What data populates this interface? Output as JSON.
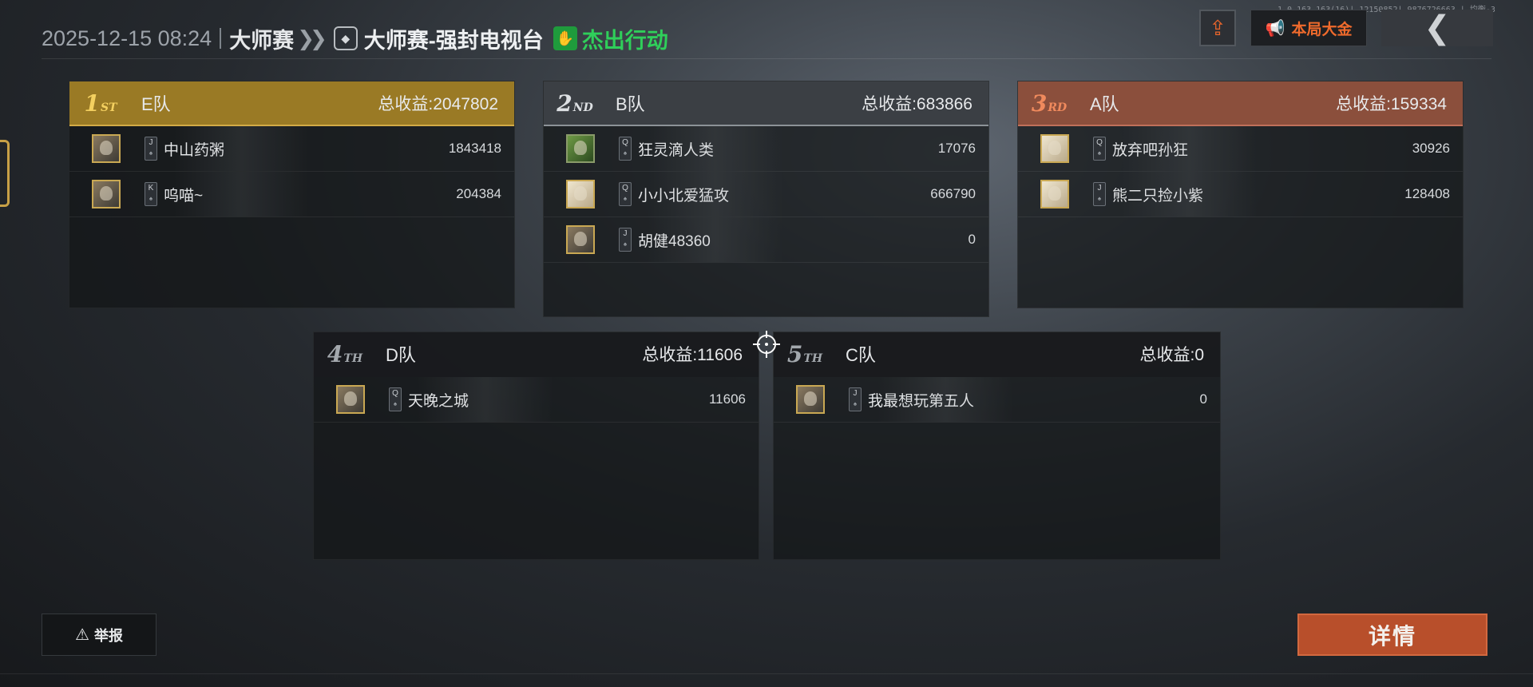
{
  "header": {
    "datetime": "2025-12-15 08:24",
    "mode": "大师赛",
    "submode": "大师赛-强封电视台",
    "action": "杰出行动"
  },
  "debug_text": "1.0.163.163(16)| 12150852| 9876726663 | 均衡-3",
  "buttons": {
    "gold_label": "本局大金",
    "report_label": "举报",
    "detail_label": "详情"
  },
  "icons": {
    "share": "share-icon",
    "megaphone": "megaphone-icon",
    "back": "back-arrow-icon",
    "warning": "warning-icon",
    "crosshair": "crosshair-icon"
  },
  "teams": [
    {
      "rank_num": "1",
      "rank_suffix": "ST",
      "name": "E队",
      "total_label": "总收益:2047802",
      "style": "gold",
      "players": [
        {
          "name": "中山药粥",
          "card": "J",
          "score": "1843418"
        },
        {
          "name": "呜喵~",
          "card": "K",
          "score": "204384"
        }
      ]
    },
    {
      "rank_num": "2",
      "rank_suffix": "ND",
      "name": "B队",
      "total_label": "总收益:683866",
      "style": "silver",
      "players": [
        {
          "name": "狂灵滴人类",
          "card": "Q",
          "score": "17076"
        },
        {
          "name": "小小北爱猛攻",
          "card": "Q",
          "score": "666790"
        },
        {
          "name": "胡健48360",
          "card": "J",
          "score": "0"
        }
      ]
    },
    {
      "rank_num": "3",
      "rank_suffix": "RD",
      "name": "A队",
      "total_label": "总收益:159334",
      "style": "bronze",
      "players": [
        {
          "name": "放弃吧孙狂",
          "card": "Q",
          "score": "30926"
        },
        {
          "name": "熊二只捡小紫",
          "card": "J",
          "score": "128408"
        }
      ]
    },
    {
      "rank_num": "4",
      "rank_suffix": "TH",
      "name": "D队",
      "total_label": "总收益:11606",
      "style": "plain",
      "players": [
        {
          "name": "天晚之城",
          "card": "Q",
          "score": "11606"
        }
      ]
    },
    {
      "rank_num": "5",
      "rank_suffix": "TH",
      "name": "C队",
      "total_label": "总收益:0",
      "style": "plain",
      "players": [
        {
          "name": "我最想玩第五人",
          "card": "J",
          "score": "0"
        }
      ]
    }
  ]
}
